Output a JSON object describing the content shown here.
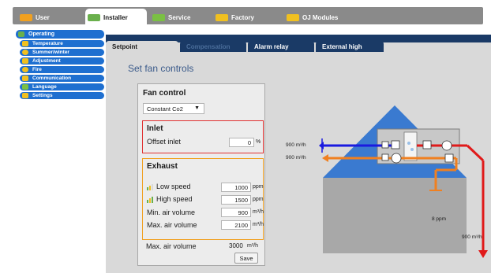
{
  "top_tabs": [
    {
      "label": "User",
      "color": "#f0a020"
    },
    {
      "label": "Installer",
      "color": "#f0c020"
    },
    {
      "label": "Service",
      "color": "#7ac043"
    },
    {
      "label": "Factory",
      "color": "#f0c020"
    },
    {
      "label": "OJ Modules",
      "color": "#f0c020"
    }
  ],
  "sidebar": {
    "items": [
      {
        "label": "Operating",
        "icon": "operating-icon",
        "color": "#6ab04c"
      },
      {
        "label": "Temperature",
        "icon": "thermometer-icon",
        "color": "#f0c020"
      },
      {
        "label": "Summer/winter",
        "icon": "sun-icon",
        "color": "#f0c020"
      },
      {
        "label": "Adjustment",
        "icon": "adjust-icon",
        "color": "#f0c020"
      },
      {
        "label": "Fire",
        "icon": "fire-icon",
        "color": "#f0c020"
      },
      {
        "label": "Communication",
        "icon": "communication-icon",
        "color": "#f0c020"
      },
      {
        "label": "Language",
        "icon": "language-icon",
        "color": "#7ac043"
      },
      {
        "label": "Settings",
        "icon": "settings-icon",
        "color": "#f0c020"
      }
    ]
  },
  "sub_tabs": [
    {
      "label": "Setpoint",
      "state": "active"
    },
    {
      "label": "Compensation",
      "state": "dim"
    },
    {
      "label": "Alarm relay",
      "state": "normal"
    },
    {
      "label": "External high",
      "state": "normal"
    }
  ],
  "page": {
    "title": "Set fan controls"
  },
  "fan_control": {
    "title": "Fan control",
    "mode": "Constant Co2",
    "inlet": {
      "title": "Inlet",
      "offset_label": "Offset inlet",
      "offset_value": "0",
      "offset_unit": "%"
    },
    "exhaust": {
      "title": "Exhaust",
      "low_label": "Low speed",
      "low_value": "1000",
      "low_unit": "ppm",
      "high_label": "High speed",
      "high_value": "1500",
      "high_unit": "ppm",
      "min_label": "Min. air volume",
      "min_value": "900",
      "min_unit": "m³/h",
      "max_label": "Max. air volume",
      "max_value": "2100",
      "max_unit": "m³/h"
    },
    "max_air_label": "Max. air volume",
    "max_air_value": "3000",
    "max_air_unit": "m³/h",
    "save_label": "Save"
  },
  "diagram": {
    "supply_flow": "900 m³/h",
    "exhaust_flow": "900 m³/h",
    "co2_reading": "8 ppm",
    "outlet_flow": "900 m³/h",
    "colors": {
      "supply": "#1a1ae0",
      "exhaust": "#f08020",
      "hot": "#e01a1a",
      "roof": "#3a7ad0"
    }
  }
}
